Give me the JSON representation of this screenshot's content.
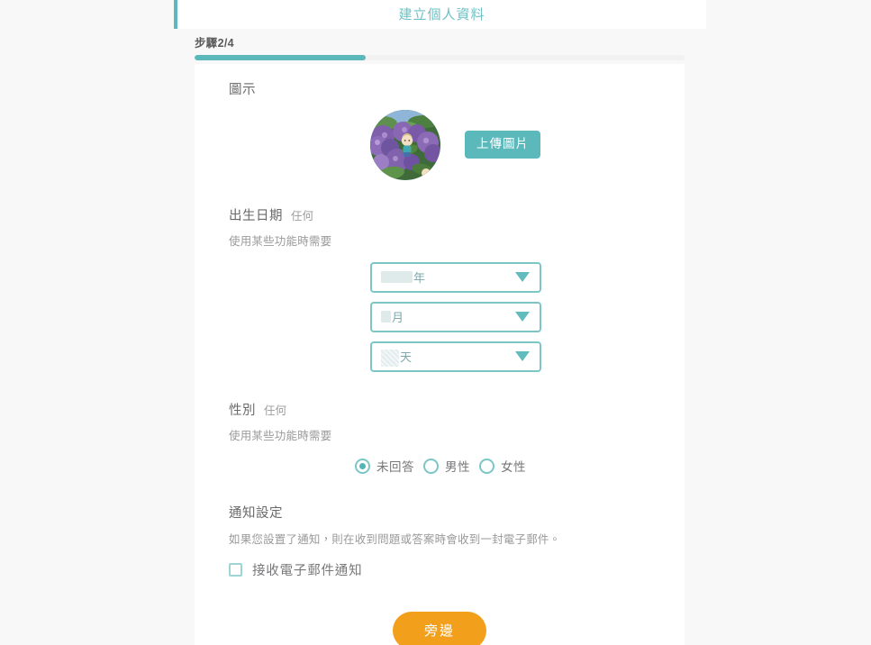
{
  "header": {
    "title": "建立個人資料",
    "accent_color": "#5bb9bc",
    "title_color": "#6ec1c4"
  },
  "progress": {
    "step_label": "步驟2/4",
    "current_step": 2,
    "total_steps": 4,
    "percent": 35,
    "fill_color": "#5bb9bc",
    "track_color": "#f2f2f2"
  },
  "icon_section": {
    "title": "圖示",
    "avatar_name": "profile-photo-hydrangea",
    "upload_label": "上傳圖片",
    "upload_color": "#5bb9bc"
  },
  "birthday_section": {
    "title": "出生日期",
    "optional": "任何",
    "description": "使用某些功能時需要",
    "fields": [
      {
        "name": "year",
        "unit": "年",
        "value": "",
        "redacted": true
      },
      {
        "name": "month",
        "unit": "月",
        "value": "",
        "redacted": true
      },
      {
        "name": "day",
        "unit": "天",
        "value": "",
        "redacted": true
      }
    ],
    "border_color": "#7cc6c6",
    "caret_color": "#62bcbe"
  },
  "gender_section": {
    "title": "性別",
    "optional": "任何",
    "description": "使用某些功能時需要",
    "options": [
      {
        "label": "未回答",
        "selected": true
      },
      {
        "label": "男性",
        "selected": false
      },
      {
        "label": "女性",
        "selected": false
      }
    ]
  },
  "notify_section": {
    "title": "通知設定",
    "description": "如果您設置了通知，則在收到問題或答案時會收到一封電子郵件。",
    "checkbox_label": "接收電子郵件通知",
    "checked": false
  },
  "footer": {
    "next_label": "旁邊",
    "next_color": "#f2a01b"
  }
}
